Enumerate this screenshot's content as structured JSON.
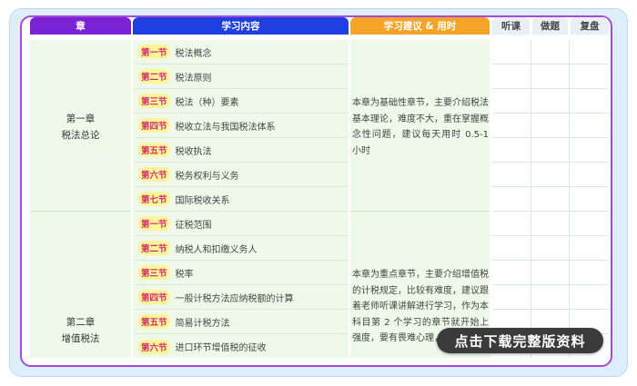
{
  "header": {
    "col_chapter": "章",
    "col_content": "学习内容",
    "col_advice": "学习建议 & 用时",
    "col_listen": "听课",
    "col_practice": "做题",
    "col_review": "复盘"
  },
  "chapters": [
    {
      "name_line1": "第一章",
      "name_line2": "税法总论",
      "advice": "本章为基础性章节，主要介绍税法基本理论，难度不大，重在掌握概念性问题，建议每天用时 0.5-1 小时",
      "sections": [
        {
          "badge": "第一节",
          "title": "税法概念"
        },
        {
          "badge": "第二节",
          "title": "税法原则"
        },
        {
          "badge": "第三节",
          "title": "税法（种）要素"
        },
        {
          "badge": "第四节",
          "title": "税收立法与我国税法体系"
        },
        {
          "badge": "第五节",
          "title": "税收执法"
        },
        {
          "badge": "第六节",
          "title": "税务权利与义务"
        },
        {
          "badge": "第七节",
          "title": "国际税收关系"
        }
      ]
    },
    {
      "name_line1": "第二章",
      "name_line2": "增值税法",
      "advice": "本章为重点章节，主要介绍增值税的计税规定，比较有难度，建议跟着老师听课讲解进行学习，作为本科目第 2 个学习的章节就开始上强度，要有畏难心理，跟着",
      "sections": [
        {
          "badge": "第一节",
          "title": "征税范围"
        },
        {
          "badge": "第二节",
          "title": "纳税人和扣缴义务人"
        },
        {
          "badge": "第三节",
          "title": "税率"
        },
        {
          "badge": "第四节",
          "title": "一般计税方法应纳税额的计算"
        },
        {
          "badge": "第五节",
          "title": "简易计税方法"
        },
        {
          "badge": "第六节",
          "title": "进口环节增值税的征收"
        }
      ]
    }
  ],
  "cta": {
    "label": "点击下载完整版资料"
  },
  "colors": {
    "header_chapter": "#7a22d6",
    "header_content": "#1f3fe0",
    "header_advice": "#f5a42a",
    "header_light": "#e9eff5",
    "frame": "#a64ad8",
    "cell_green": "#eff9ea",
    "badge_bg": "#fff59a",
    "badge_text": "#d22b6b"
  }
}
